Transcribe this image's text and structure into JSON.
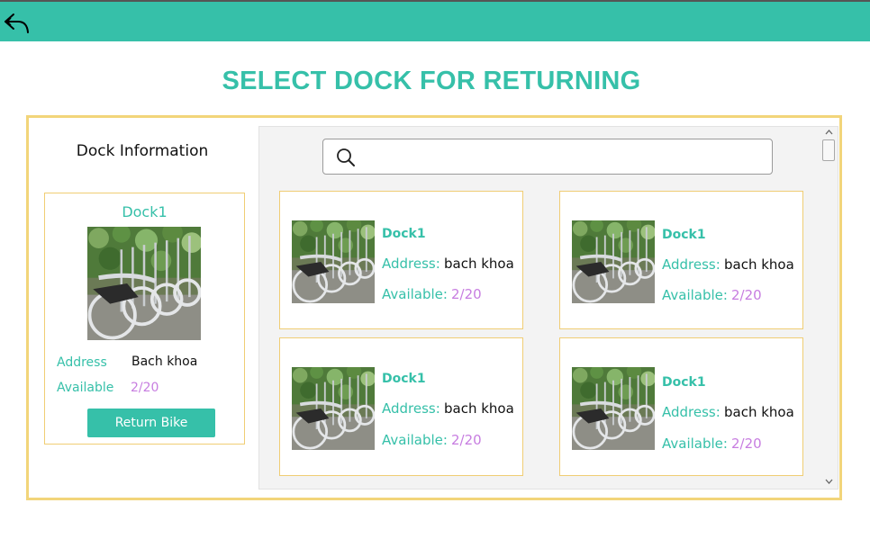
{
  "header": {
    "back_icon": "reply-arrow-icon",
    "bar_color": "#36c0a9"
  },
  "page": {
    "title": "SELECT DOCK FOR RETURNING"
  },
  "info": {
    "heading": "Dock Information",
    "dock_name": "Dock1",
    "image": "bike-dock-photo",
    "address_label": "Address",
    "address_value": "Bach khoa",
    "available_label": "Available",
    "available_value": "2/20",
    "return_button": "Return Bike"
  },
  "search": {
    "icon": "search-icon",
    "value": "",
    "placeholder": ""
  },
  "docks": [
    {
      "name": "Dock1",
      "address_label": "Address:",
      "address": "bach khoa",
      "available_label": "Available:",
      "available": "2/20"
    },
    {
      "name": "Dock1",
      "address_label": "Address:",
      "address": "bach khoa",
      "available_label": "Available:",
      "available": "2/20"
    },
    {
      "name": "Dock1",
      "address_label": "Address:",
      "address": "bach khoa",
      "available_label": "Available:",
      "available": "2/20"
    },
    {
      "name": "Dock1",
      "address_label": "Address:",
      "address": "bach khoa",
      "available_label": "Available:",
      "available": "2/20"
    }
  ],
  "colors": {
    "accent": "#36c0a9",
    "border": "#f2d57a",
    "available": "#c77de0"
  }
}
